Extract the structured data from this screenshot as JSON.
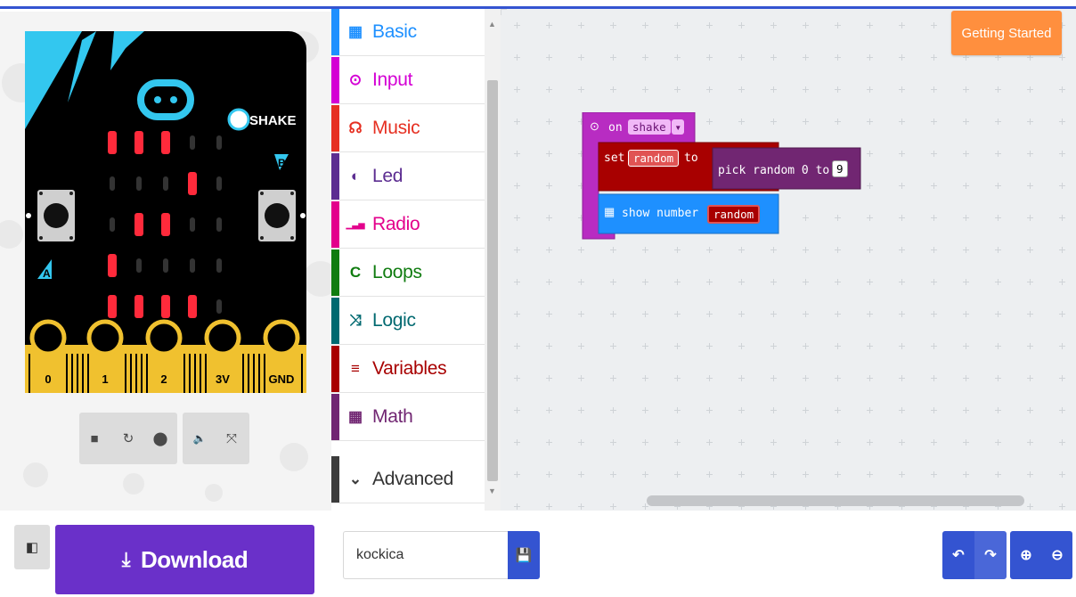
{
  "simulator": {
    "pins": [
      "0",
      "1",
      "2",
      "3V",
      "GND"
    ],
    "shake_label": "SHAKE",
    "button_a": "A",
    "button_b": "B",
    "led_matrix": [
      [
        1,
        1,
        1,
        0,
        0
      ],
      [
        0,
        0,
        0,
        1,
        0
      ],
      [
        0,
        1,
        1,
        0,
        0
      ],
      [
        1,
        0,
        0,
        0,
        0
      ],
      [
        1,
        1,
        1,
        1,
        0
      ]
    ],
    "controls": [
      "stop-icon",
      "restart-icon",
      "debug-icon",
      "mute-icon",
      "fullscreen-icon"
    ]
  },
  "toolbox": {
    "categories": [
      {
        "label": "Basic",
        "icon": "grid-icon",
        "color": "#1e90ff"
      },
      {
        "label": "Input",
        "icon": "target-icon",
        "color": "#d400d4"
      },
      {
        "label": "Music",
        "icon": "headphones-icon",
        "color": "#e63022"
      },
      {
        "label": "Led",
        "icon": "half-circle-icon",
        "color": "#5c2d91"
      },
      {
        "label": "Radio",
        "icon": "signal-icon",
        "color": "#e3008c"
      },
      {
        "label": "Loops",
        "icon": "loop-icon",
        "color": "#107c10"
      },
      {
        "label": "Logic",
        "icon": "shuffle-icon",
        "color": "#006970"
      },
      {
        "label": "Variables",
        "icon": "lines-icon",
        "color": "#a80000"
      },
      {
        "label": "Math",
        "icon": "calculator-icon",
        "color": "#712672"
      },
      {
        "label": "Advanced",
        "icon": "chevron-down-icon",
        "color": "#3c3c3c"
      }
    ]
  },
  "workspace": {
    "getting_started": "Getting Started",
    "event_block": {
      "on": "on",
      "event": "shake"
    },
    "set_block": {
      "set": "set",
      "variable": "random",
      "to": "to"
    },
    "pick_block": {
      "label": "pick random 0 to",
      "value": "9"
    },
    "show_block": {
      "label": "show number",
      "variable": "random"
    }
  },
  "bottombar": {
    "download_label": "Download",
    "project_name": "kockica"
  },
  "colors": {
    "accent": "#3454d1",
    "download": "#6a30c9",
    "getting_started": "#ff8f3e",
    "event_block": "#b82cc2",
    "variables_block": "#a80000",
    "math_block": "#712672",
    "basic_block": "#1e90ff"
  }
}
